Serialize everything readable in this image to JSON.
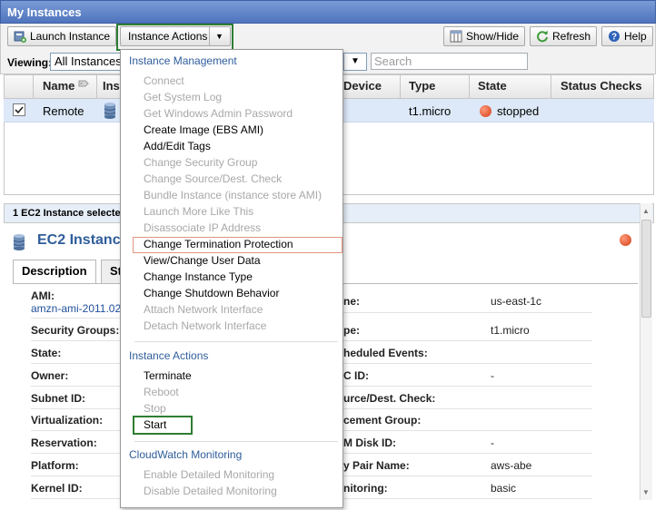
{
  "title": "My Instances",
  "toolbar": {
    "launch_label": "Launch Instance",
    "actions_label": "Instance Actions",
    "showhide_label": "Show/Hide",
    "refresh_label": "Refresh",
    "help_label": "Help"
  },
  "viewing": {
    "label": "Viewing:",
    "value": "All Instances",
    "search_placeholder": "Search"
  },
  "grid": {
    "columns": [
      "Name",
      "Ins",
      "Device",
      "Type",
      "State",
      "Status Checks"
    ],
    "row": {
      "name": "Remote",
      "type": "t1.micro",
      "state": "stopped"
    }
  },
  "lower": {
    "selected_count": "1 EC2 Instance selecte",
    "title": "EC2 Instanc",
    "tabs": [
      "Description",
      "St"
    ],
    "left_labels": [
      "AMI:",
      "Security Groups:",
      "State:",
      "Owner:",
      "Subnet ID:",
      "Virtualization:",
      "Reservation:",
      "Platform:",
      "Kernel ID:"
    ],
    "ami_value": "amzn-ami-2011.02",
    "right_labels": [
      "ne:",
      "pe:",
      "heduled Events:",
      "C ID:",
      "urce/Dest. Check:",
      "cement Group:",
      "M Disk ID:",
      "y Pair Name:",
      "nitoring:"
    ],
    "right_values": [
      "us-east-1c",
      "t1.micro",
      "",
      "-",
      "",
      "",
      "-",
      "aws-abe",
      "basic"
    ]
  },
  "menu": {
    "section_management": "Instance Management",
    "management_items": [
      {
        "label": "Connect",
        "enabled": false
      },
      {
        "label": "Get System Log",
        "enabled": false
      },
      {
        "label": "Get Windows Admin Password",
        "enabled": false
      },
      {
        "label": "Create Image (EBS AMI)",
        "enabled": true
      },
      {
        "label": "Add/Edit Tags",
        "enabled": true
      },
      {
        "label": "Change Security Group",
        "enabled": false
      },
      {
        "label": "Change Source/Dest. Check",
        "enabled": false
      },
      {
        "label": "Bundle Instance (instance store AMI)",
        "enabled": false
      },
      {
        "label": "Launch More Like This",
        "enabled": false
      },
      {
        "label": "Disassociate IP Address",
        "enabled": false
      },
      {
        "label": "Change Termination Protection",
        "enabled": true
      },
      {
        "label": "View/Change User Data",
        "enabled": true
      },
      {
        "label": "Change Instance Type",
        "enabled": true
      },
      {
        "label": "Change Shutdown Behavior",
        "enabled": true
      },
      {
        "label": "Attach Network Interface",
        "enabled": false
      },
      {
        "label": "Detach Network Interface",
        "enabled": false
      }
    ],
    "section_actions": "Instance Actions",
    "action_items": [
      {
        "label": "Terminate",
        "enabled": true
      },
      {
        "label": "Reboot",
        "enabled": false
      },
      {
        "label": "Stop",
        "enabled": false
      },
      {
        "label": "Start",
        "enabled": true
      }
    ],
    "section_cloudwatch": "CloudWatch Monitoring",
    "cloudwatch_items": [
      {
        "label": "Enable Detailed Monitoring",
        "enabled": false
      },
      {
        "label": "Disable Detailed Monitoring",
        "enabled": false
      }
    ]
  },
  "colors": {
    "title_bar": "#4f74be",
    "selected_row": "#dde8f8",
    "menu_section": "#2f5d9b",
    "disabled_text": "#a8a8a8",
    "highlight_green": "#2e7d32",
    "highlight_orange": "#e3957d",
    "stopped_dot": "#d23b12"
  }
}
